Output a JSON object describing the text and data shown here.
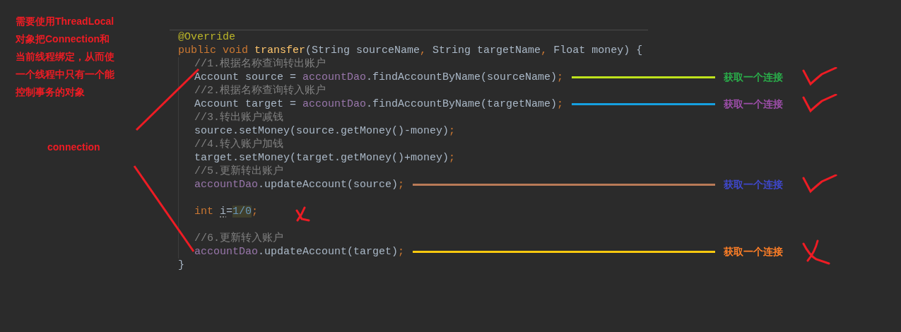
{
  "note": {
    "lines": [
      "需要使用ThreadLocal",
      "对象把Connection和",
      "当前线程绑定，从而使",
      "一个线程中只有一个能",
      "控制事务的对象"
    ]
  },
  "side_label": "connection",
  "code": {
    "header": [
      {
        "kind": "annotation",
        "text": "@Override"
      }
    ],
    "signature": [
      {
        "kind": "keyword",
        "text": "public void "
      },
      {
        "kind": "method",
        "text": "transfer"
      },
      {
        "kind": "plain",
        "text": "(String sourceName"
      },
      {
        "kind": "keyword",
        "text": ", "
      },
      {
        "kind": "plain",
        "text": "String targetName"
      },
      {
        "kind": "keyword",
        "text": ", "
      },
      {
        "kind": "plain",
        "text": "Float money) {"
      }
    ],
    "body": [
      {
        "kind": "line",
        "tokens": [
          {
            "kind": "comment",
            "text": "//1.根据名称查询转出账户"
          }
        ]
      },
      {
        "kind": "line",
        "tokens": [
          {
            "kind": "plain",
            "text": "Account source = "
          },
          {
            "kind": "field",
            "text": "accountDao"
          },
          {
            "kind": "plain",
            "text": ".findAccountByName(sourceName)"
          },
          {
            "kind": "keyword",
            "text": ";"
          }
        ],
        "note": {
          "connector": {
            "color": "#bfe31c"
          },
          "label": {
            "text": "获取一个连接",
            "color": "#2aad4a"
          },
          "mark": {
            "kind": "check"
          }
        }
      },
      {
        "kind": "line",
        "tokens": [
          {
            "kind": "comment",
            "text": "//2.根据名称查询转入账户"
          }
        ]
      },
      {
        "kind": "line",
        "tokens": [
          {
            "kind": "plain",
            "text": "Account target = "
          },
          {
            "kind": "field",
            "text": "accountDao"
          },
          {
            "kind": "plain",
            "text": ".findAccountByName(targetName)"
          },
          {
            "kind": "keyword",
            "text": ";"
          }
        ],
        "note": {
          "connector": {
            "color": "#15a0e0"
          },
          "label": {
            "text": "获取一个连接",
            "color": "#9c4ea8"
          },
          "mark": {
            "kind": "check"
          }
        }
      },
      {
        "kind": "line",
        "tokens": [
          {
            "kind": "comment",
            "text": "//3.转出账户减钱"
          }
        ]
      },
      {
        "kind": "line",
        "tokens": [
          {
            "kind": "plain",
            "text": "source.setMoney(source.getMoney()-money)"
          },
          {
            "kind": "keyword",
            "text": ";"
          }
        ]
      },
      {
        "kind": "line",
        "tokens": [
          {
            "kind": "comment",
            "text": "//4.转入账户加钱"
          }
        ]
      },
      {
        "kind": "line",
        "tokens": [
          {
            "kind": "plain",
            "text": "target.setMoney(target.getMoney()+money)"
          },
          {
            "kind": "keyword",
            "text": ";"
          }
        ]
      },
      {
        "kind": "line",
        "tokens": [
          {
            "kind": "comment",
            "text": "//5.更新转出账户"
          }
        ]
      },
      {
        "kind": "line",
        "tokens": [
          {
            "kind": "field",
            "text": "accountDao"
          },
          {
            "kind": "plain",
            "text": ".updateAccount(source)"
          },
          {
            "kind": "keyword",
            "text": ";"
          }
        ],
        "note": {
          "connector": {
            "color": "#b97a57"
          },
          "label": {
            "text": "获取一个连接",
            "color": "#3f48cc"
          },
          "mark": {
            "kind": "check"
          }
        }
      },
      {
        "kind": "blank"
      },
      {
        "kind": "line",
        "tokens": [
          {
            "kind": "keyword",
            "text": "int "
          },
          {
            "kind": "plain",
            "text": "i",
            "warned": true
          },
          {
            "kind": "plain",
            "text": "="
          },
          {
            "kind": "number",
            "text": "1/0",
            "highlighted": true
          },
          {
            "kind": "keyword",
            "text": ";"
          }
        ]
      },
      {
        "kind": "blank"
      },
      {
        "kind": "line",
        "tokens": [
          {
            "kind": "comment",
            "text": "//6.更新转入账户"
          }
        ]
      },
      {
        "kind": "line",
        "tokens": [
          {
            "kind": "field",
            "text": "accountDao"
          },
          {
            "kind": "plain",
            "text": ".updateAccount(target)"
          },
          {
            "kind": "keyword",
            "text": ";"
          }
        ],
        "note": {
          "connector": {
            "color": "#ffc90e"
          },
          "label": {
            "text": "获取一个连接",
            "color": "#ff7f27"
          },
          "mark": {
            "kind": "cross"
          }
        }
      }
    ],
    "closing": [
      {
        "kind": "plain",
        "text": "}"
      }
    ]
  }
}
